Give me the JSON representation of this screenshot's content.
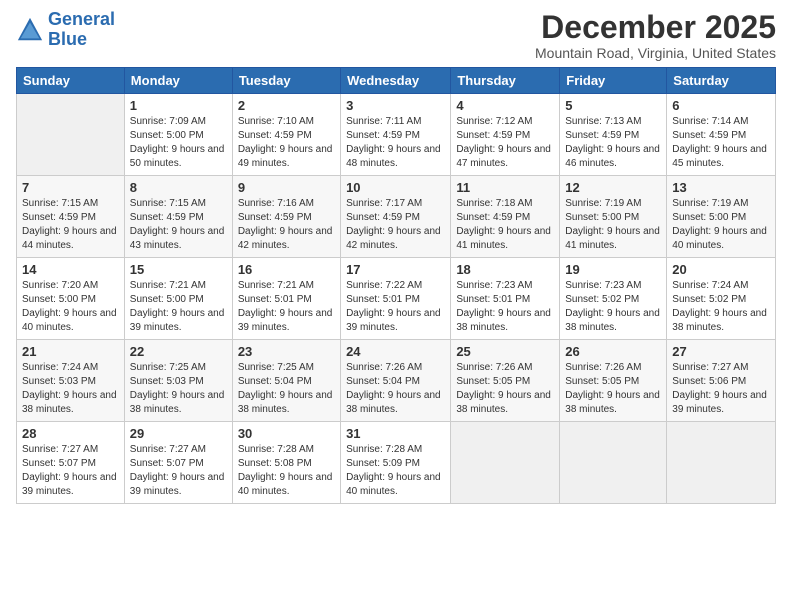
{
  "header": {
    "logo_line1": "General",
    "logo_line2": "Blue",
    "month": "December 2025",
    "location": "Mountain Road, Virginia, United States"
  },
  "weekdays": [
    "Sunday",
    "Monday",
    "Tuesday",
    "Wednesday",
    "Thursday",
    "Friday",
    "Saturday"
  ],
  "weeks": [
    [
      {
        "day": "",
        "sunrise": "",
        "sunset": "",
        "daylight": ""
      },
      {
        "day": "1",
        "sunrise": "Sunrise: 7:09 AM",
        "sunset": "Sunset: 5:00 PM",
        "daylight": "Daylight: 9 hours and 50 minutes."
      },
      {
        "day": "2",
        "sunrise": "Sunrise: 7:10 AM",
        "sunset": "Sunset: 4:59 PM",
        "daylight": "Daylight: 9 hours and 49 minutes."
      },
      {
        "day": "3",
        "sunrise": "Sunrise: 7:11 AM",
        "sunset": "Sunset: 4:59 PM",
        "daylight": "Daylight: 9 hours and 48 minutes."
      },
      {
        "day": "4",
        "sunrise": "Sunrise: 7:12 AM",
        "sunset": "Sunset: 4:59 PM",
        "daylight": "Daylight: 9 hours and 47 minutes."
      },
      {
        "day": "5",
        "sunrise": "Sunrise: 7:13 AM",
        "sunset": "Sunset: 4:59 PM",
        "daylight": "Daylight: 9 hours and 46 minutes."
      },
      {
        "day": "6",
        "sunrise": "Sunrise: 7:14 AM",
        "sunset": "Sunset: 4:59 PM",
        "daylight": "Daylight: 9 hours and 45 minutes."
      }
    ],
    [
      {
        "day": "7",
        "sunrise": "Sunrise: 7:15 AM",
        "sunset": "Sunset: 4:59 PM",
        "daylight": "Daylight: 9 hours and 44 minutes."
      },
      {
        "day": "8",
        "sunrise": "Sunrise: 7:15 AM",
        "sunset": "Sunset: 4:59 PM",
        "daylight": "Daylight: 9 hours and 43 minutes."
      },
      {
        "day": "9",
        "sunrise": "Sunrise: 7:16 AM",
        "sunset": "Sunset: 4:59 PM",
        "daylight": "Daylight: 9 hours and 42 minutes."
      },
      {
        "day": "10",
        "sunrise": "Sunrise: 7:17 AM",
        "sunset": "Sunset: 4:59 PM",
        "daylight": "Daylight: 9 hours and 42 minutes."
      },
      {
        "day": "11",
        "sunrise": "Sunrise: 7:18 AM",
        "sunset": "Sunset: 4:59 PM",
        "daylight": "Daylight: 9 hours and 41 minutes."
      },
      {
        "day": "12",
        "sunrise": "Sunrise: 7:19 AM",
        "sunset": "Sunset: 5:00 PM",
        "daylight": "Daylight: 9 hours and 41 minutes."
      },
      {
        "day": "13",
        "sunrise": "Sunrise: 7:19 AM",
        "sunset": "Sunset: 5:00 PM",
        "daylight": "Daylight: 9 hours and 40 minutes."
      }
    ],
    [
      {
        "day": "14",
        "sunrise": "Sunrise: 7:20 AM",
        "sunset": "Sunset: 5:00 PM",
        "daylight": "Daylight: 9 hours and 40 minutes."
      },
      {
        "day": "15",
        "sunrise": "Sunrise: 7:21 AM",
        "sunset": "Sunset: 5:00 PM",
        "daylight": "Daylight: 9 hours and 39 minutes."
      },
      {
        "day": "16",
        "sunrise": "Sunrise: 7:21 AM",
        "sunset": "Sunset: 5:01 PM",
        "daylight": "Daylight: 9 hours and 39 minutes."
      },
      {
        "day": "17",
        "sunrise": "Sunrise: 7:22 AM",
        "sunset": "Sunset: 5:01 PM",
        "daylight": "Daylight: 9 hours and 39 minutes."
      },
      {
        "day": "18",
        "sunrise": "Sunrise: 7:23 AM",
        "sunset": "Sunset: 5:01 PM",
        "daylight": "Daylight: 9 hours and 38 minutes."
      },
      {
        "day": "19",
        "sunrise": "Sunrise: 7:23 AM",
        "sunset": "Sunset: 5:02 PM",
        "daylight": "Daylight: 9 hours and 38 minutes."
      },
      {
        "day": "20",
        "sunrise": "Sunrise: 7:24 AM",
        "sunset": "Sunset: 5:02 PM",
        "daylight": "Daylight: 9 hours and 38 minutes."
      }
    ],
    [
      {
        "day": "21",
        "sunrise": "Sunrise: 7:24 AM",
        "sunset": "Sunset: 5:03 PM",
        "daylight": "Daylight: 9 hours and 38 minutes."
      },
      {
        "day": "22",
        "sunrise": "Sunrise: 7:25 AM",
        "sunset": "Sunset: 5:03 PM",
        "daylight": "Daylight: 9 hours and 38 minutes."
      },
      {
        "day": "23",
        "sunrise": "Sunrise: 7:25 AM",
        "sunset": "Sunset: 5:04 PM",
        "daylight": "Daylight: 9 hours and 38 minutes."
      },
      {
        "day": "24",
        "sunrise": "Sunrise: 7:26 AM",
        "sunset": "Sunset: 5:04 PM",
        "daylight": "Daylight: 9 hours and 38 minutes."
      },
      {
        "day": "25",
        "sunrise": "Sunrise: 7:26 AM",
        "sunset": "Sunset: 5:05 PM",
        "daylight": "Daylight: 9 hours and 38 minutes."
      },
      {
        "day": "26",
        "sunrise": "Sunrise: 7:26 AM",
        "sunset": "Sunset: 5:05 PM",
        "daylight": "Daylight: 9 hours and 38 minutes."
      },
      {
        "day": "27",
        "sunrise": "Sunrise: 7:27 AM",
        "sunset": "Sunset: 5:06 PM",
        "daylight": "Daylight: 9 hours and 39 minutes."
      }
    ],
    [
      {
        "day": "28",
        "sunrise": "Sunrise: 7:27 AM",
        "sunset": "Sunset: 5:07 PM",
        "daylight": "Daylight: 9 hours and 39 minutes."
      },
      {
        "day": "29",
        "sunrise": "Sunrise: 7:27 AM",
        "sunset": "Sunset: 5:07 PM",
        "daylight": "Daylight: 9 hours and 39 minutes."
      },
      {
        "day": "30",
        "sunrise": "Sunrise: 7:28 AM",
        "sunset": "Sunset: 5:08 PM",
        "daylight": "Daylight: 9 hours and 40 minutes."
      },
      {
        "day": "31",
        "sunrise": "Sunrise: 7:28 AM",
        "sunset": "Sunset: 5:09 PM",
        "daylight": "Daylight: 9 hours and 40 minutes."
      },
      {
        "day": "",
        "sunrise": "",
        "sunset": "",
        "daylight": ""
      },
      {
        "day": "",
        "sunrise": "",
        "sunset": "",
        "daylight": ""
      },
      {
        "day": "",
        "sunrise": "",
        "sunset": "",
        "daylight": ""
      }
    ]
  ]
}
